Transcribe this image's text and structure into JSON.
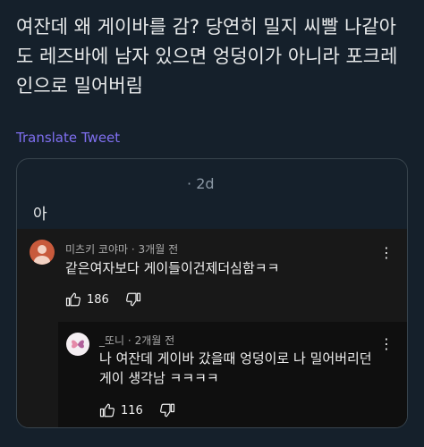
{
  "tweet": {
    "text": "여잔데 왜 게이바를 감? 당연히 밀지 씨빨 나같아도 레즈바에 남자 있으면 엉덩이가 아니라 포크레인으로 밀어버림",
    "translate_label": "Translate Tweet"
  },
  "quote": {
    "dot": "·",
    "time": "2d",
    "text": "아"
  },
  "comments": [
    {
      "author": "미츠키 코야마",
      "sep": "·",
      "time": "3개월 전",
      "text": "같은여자보다 게이들이건제더심함ㅋㅋ",
      "likes": "186",
      "avatar_color": "#c85a3c",
      "more_glyph": "⋮"
    },
    {
      "author": "_또니",
      "sep": "·",
      "time": "2개월 전",
      "text_line1": "나 여잔데 게이바 갔을때 엉덩이로 나 밀어버리던",
      "text_line2": "게이 생각남 ㅋㅋㅋㅋ",
      "likes": "116",
      "avatar_color": "#f4eef2",
      "more_glyph": "⋮"
    }
  ],
  "colors": {
    "background": "#15202b",
    "translate_link": "#7f6ff0",
    "youtube_dark": "#181818",
    "reply_dark": "#0f0f0f"
  }
}
